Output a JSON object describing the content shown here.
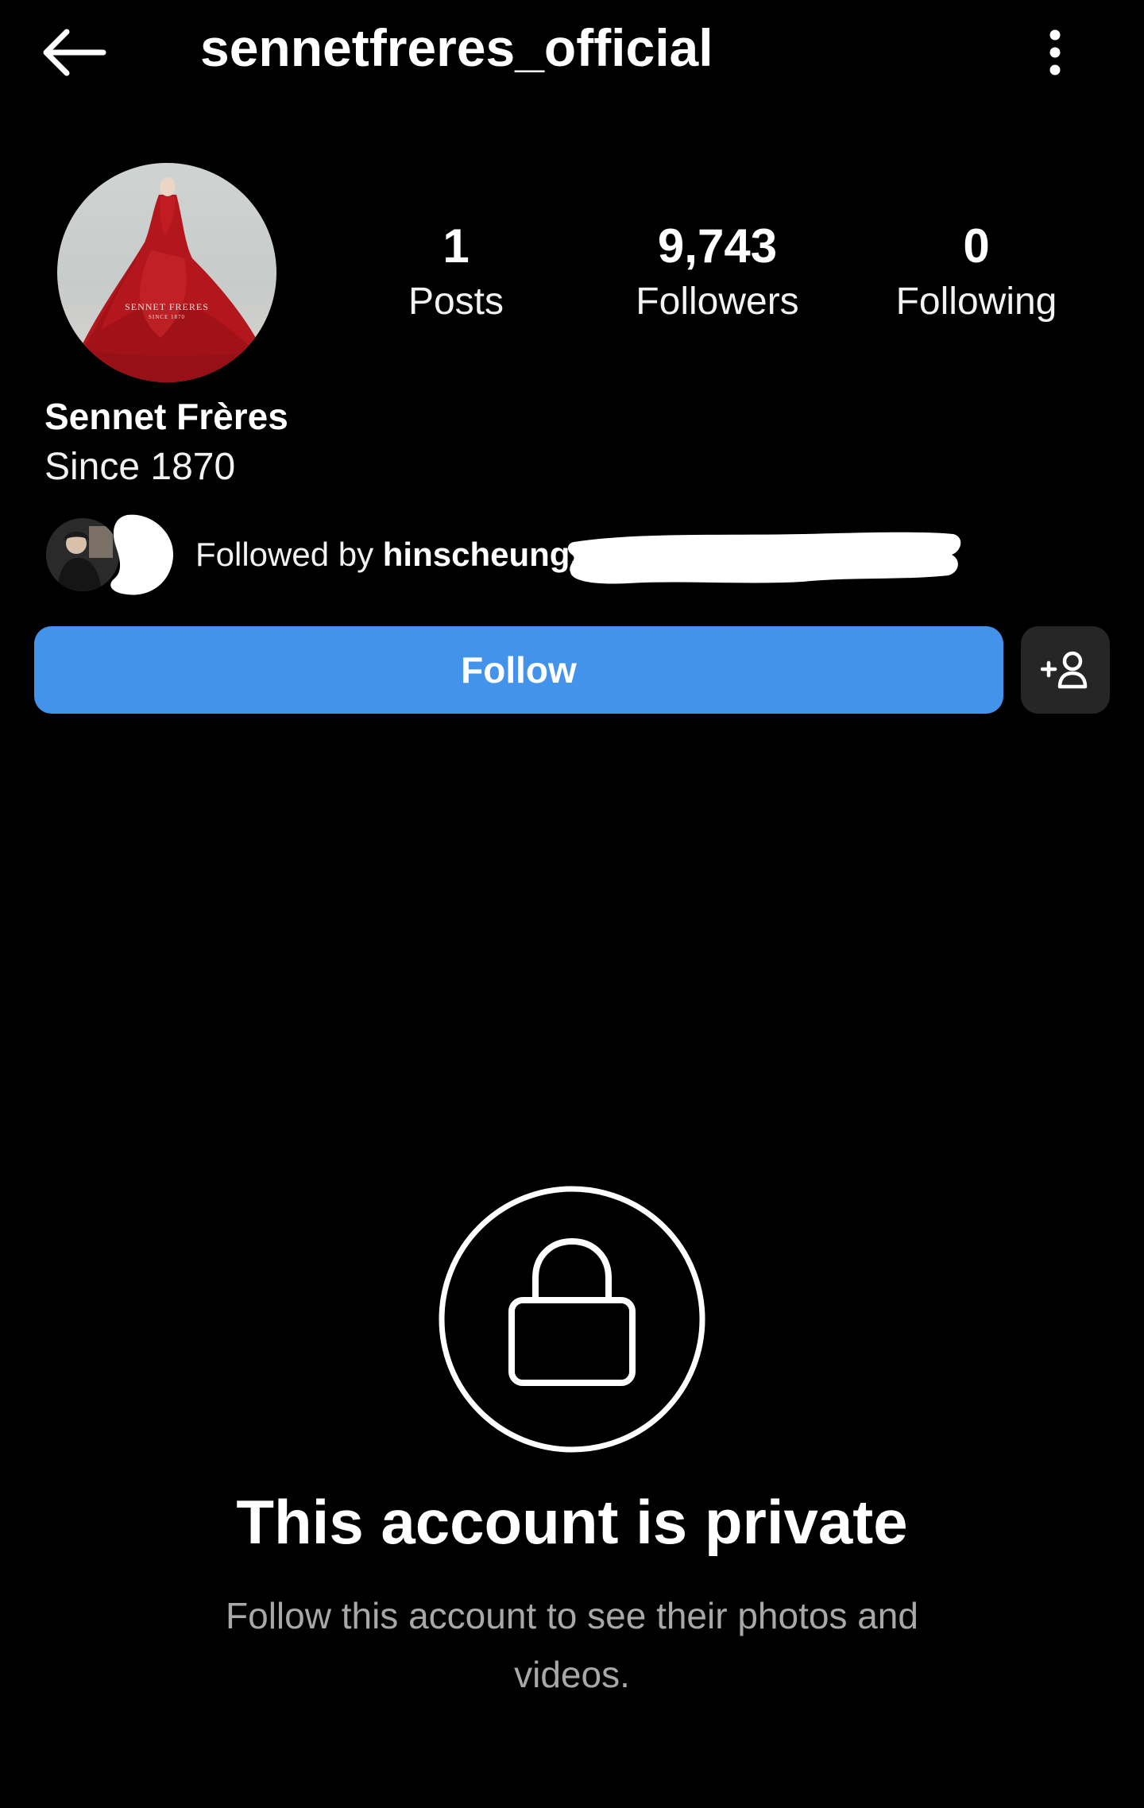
{
  "header": {
    "username": "sennetfreres_official"
  },
  "avatar": {
    "brand_text": "SENNET FRERES",
    "sub_text": "SINCE 1870"
  },
  "stats": {
    "posts": {
      "value": "1",
      "label": "Posts"
    },
    "followers": {
      "value": "9,743",
      "label": "Followers"
    },
    "following": {
      "value": "0",
      "label": "Following"
    }
  },
  "profile": {
    "display_name": "Sennet Frères",
    "bio": "Since 1870"
  },
  "followed_by": {
    "prefix": "Followed by ",
    "name": "hinscheung,"
  },
  "actions": {
    "follow_label": "Follow"
  },
  "private": {
    "title": "This account is private",
    "subtitle": "Follow this account to see their photos and videos."
  },
  "colors": {
    "background": "#000000",
    "follow_button": "#4493eb",
    "secondary_button": "#262626",
    "muted_text": "#a8a8a8"
  },
  "icons": [
    "back-arrow-icon",
    "more-vertical-icon",
    "add-person-icon",
    "lock-icon"
  ]
}
